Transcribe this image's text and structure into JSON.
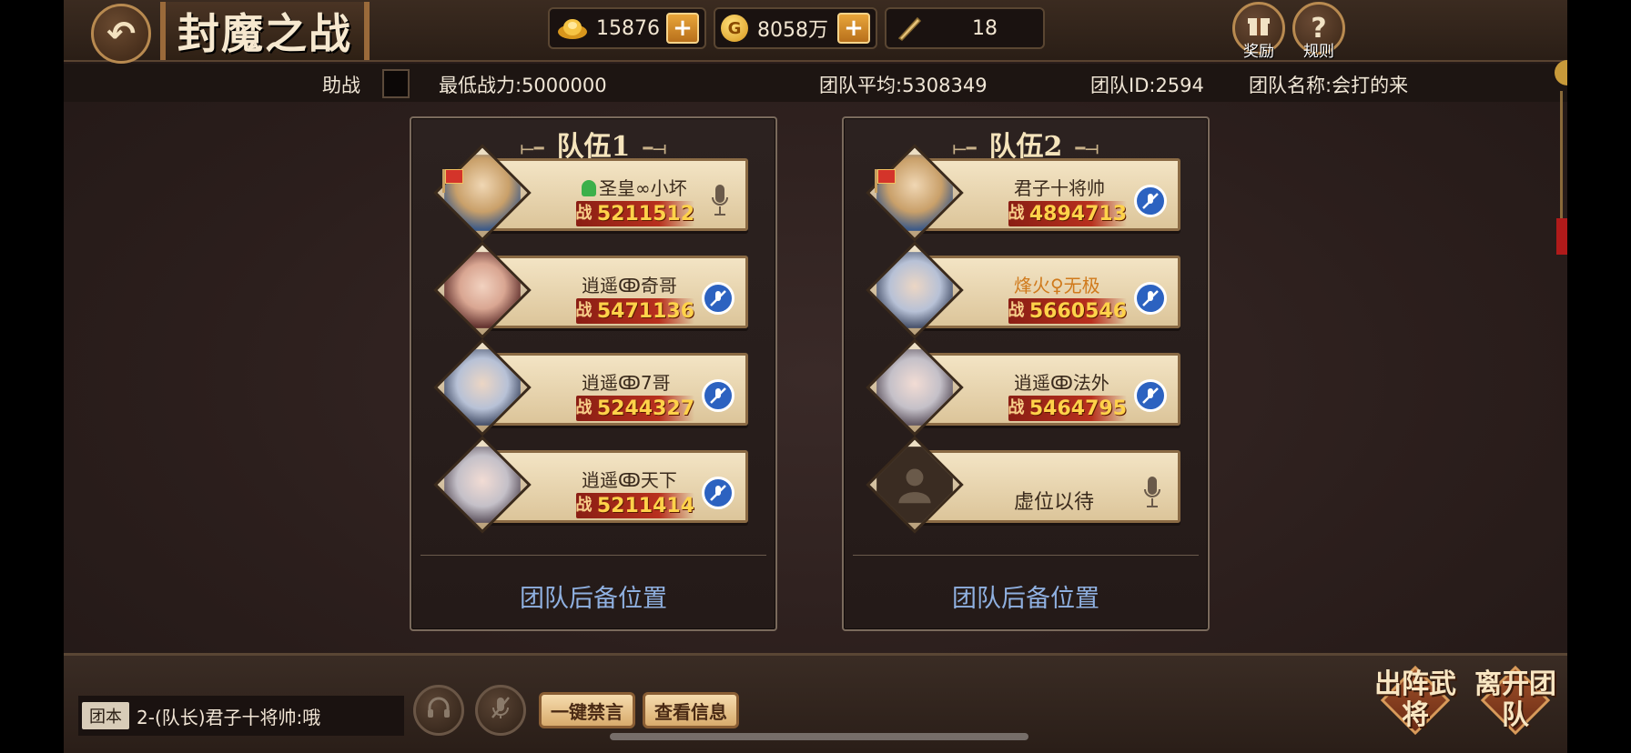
{
  "header": {
    "title": "封魔之战",
    "back_icon": "back-arrow-icon",
    "currencies": [
      {
        "icon": "gold-ingot-icon",
        "value": "15876",
        "has_add": true
      },
      {
        "icon": "coin-icon",
        "coin_glyph": "G",
        "value": "8058万",
        "has_add": true
      },
      {
        "icon": "token-icon",
        "value": "18",
        "has_add": false
      }
    ],
    "plus_symbol": "+",
    "reward_label": "奖励",
    "rules_label": "规则"
  },
  "info": {
    "assist_label": "助战",
    "min_power_label": "最低战力:5000000",
    "team_avg_label": "团队平均:5308349",
    "team_id_label": "团队ID:2594",
    "team_name_label": "团队名称:会打的来"
  },
  "teams": [
    {
      "title": "队伍1",
      "members": [
        {
          "name": "圣皇∞小坏",
          "power": "5211512",
          "leader": true,
          "online": true,
          "voice": "mic",
          "avatar": "old"
        },
        {
          "name": "逍遥ↂ奇哥",
          "power": "5471136",
          "leader": false,
          "online": false,
          "voice": "muted",
          "avatar": "girl"
        },
        {
          "name": "逍遥ↂ7哥",
          "power": "5244327",
          "leader": false,
          "online": false,
          "voice": "muted",
          "avatar": "boy"
        },
        {
          "name": "逍遥ↂ天下",
          "power": "5211414",
          "leader": false,
          "online": false,
          "voice": "muted",
          "avatar": "silver"
        }
      ],
      "reserve_label": "团队后备位置"
    },
    {
      "title": "队伍2",
      "members": [
        {
          "name": "君子十将帅",
          "power": "4894713",
          "leader": true,
          "online": false,
          "voice": "muted",
          "avatar": "old"
        },
        {
          "name": "烽火♀无极",
          "power": "5660546",
          "leader": false,
          "online": false,
          "voice": "muted",
          "avatar": "boy",
          "name_color": "orange"
        },
        {
          "name": "逍遥ↂ法外",
          "power": "5464795",
          "leader": false,
          "online": false,
          "voice": "muted",
          "avatar": "silver"
        },
        {
          "name": "虚位以待",
          "power": "",
          "leader": false,
          "online": false,
          "voice": "mic",
          "avatar": "empty"
        }
      ],
      "reserve_label": "团队后备位置"
    }
  ],
  "power_badge": "战",
  "bottom": {
    "chat_channel": "团本",
    "chat_message": "2-(队长)君子十将帅:哦",
    "mute_all_label": "一键禁言",
    "view_info_label": "查看信息",
    "deploy_label": "出阵武将",
    "leave_label": "离开团队"
  }
}
